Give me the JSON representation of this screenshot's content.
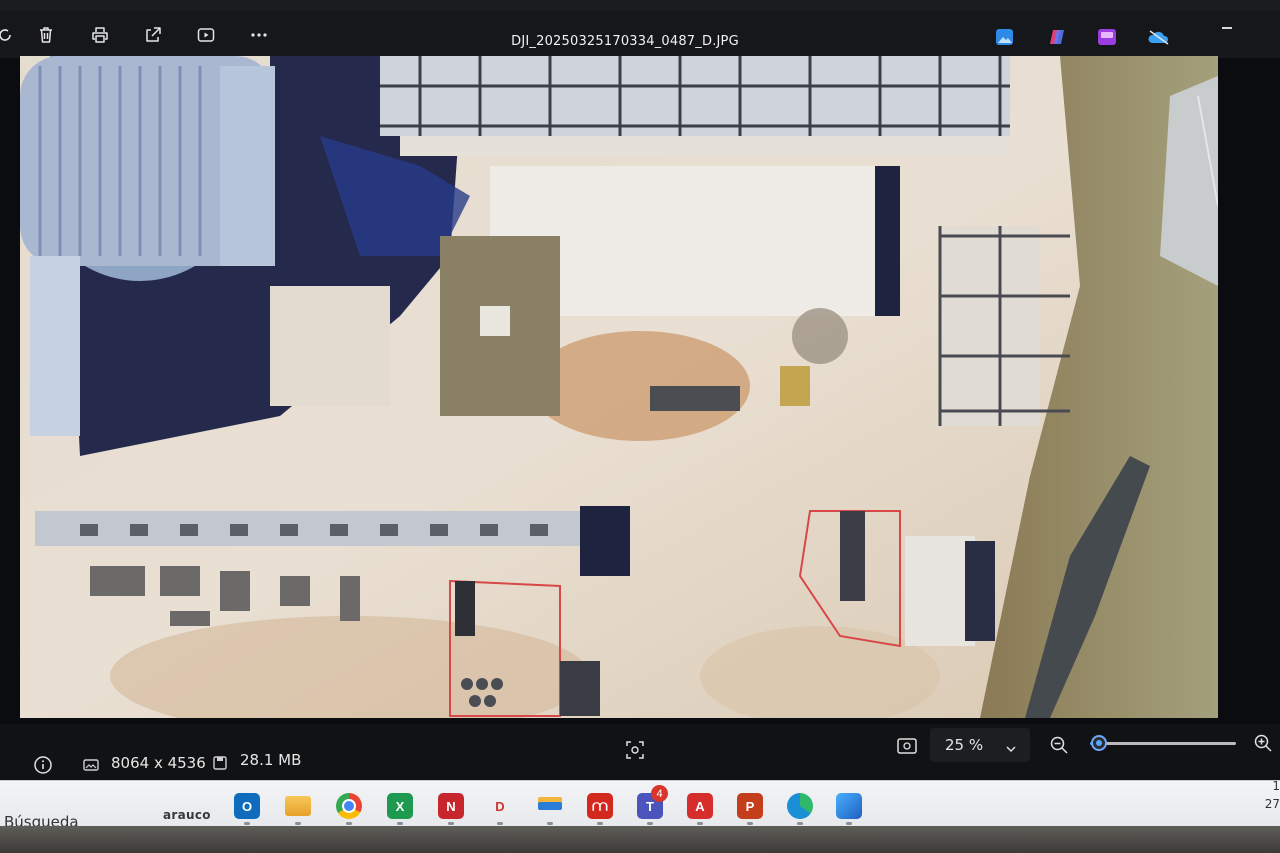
{
  "window": {
    "title": "DJI_20250325170334_0487_D.JPG"
  },
  "toolbar": {
    "buttons": [
      {
        "name": "delete",
        "icon": "trash-icon"
      },
      {
        "name": "print",
        "icon": "printer-icon"
      },
      {
        "name": "share",
        "icon": "share-icon"
      },
      {
        "name": "slideshow",
        "icon": "play-icon"
      },
      {
        "name": "more",
        "icon": "ellipsis-icon"
      }
    ],
    "app_icons": [
      "photos-edit-icon",
      "copilot-icon",
      "clipchamp-icon",
      "onedrive-icon"
    ]
  },
  "status": {
    "dimensions": "8064 x 4536",
    "file_size": "28.1 MB",
    "zoom_label": "25 %",
    "zoom_fraction": 0.05
  },
  "taskbar": {
    "search_label": "Búsqueda",
    "search_brand": "arauco",
    "teams_badge": "4",
    "apps": [
      {
        "name": "outlook",
        "icon": "outlook-icon",
        "color": "#0f6cbd",
        "glyph": "O"
      },
      {
        "name": "file-explorer",
        "icon": "folder-icon",
        "color": "#f4b63f",
        "glyph": ""
      },
      {
        "name": "chrome",
        "icon": "chrome-icon",
        "color": "#34a853",
        "glyph": ""
      },
      {
        "name": "excel",
        "icon": "excel-icon",
        "color": "#1d9a4f",
        "glyph": "X"
      },
      {
        "name": "news",
        "icon": "news-icon",
        "color": "#c8262d",
        "glyph": "N"
      },
      {
        "name": "app-d",
        "icon": "d-app-icon",
        "color": "#ffffff",
        "glyph": "D"
      },
      {
        "name": "folder-app",
        "icon": "stack-icon",
        "color": "#ffffff",
        "glyph": ""
      },
      {
        "name": "acrobat",
        "icon": "pdf-icon",
        "color": "#d2281e",
        "glyph": ""
      },
      {
        "name": "teams",
        "icon": "teams-icon",
        "color": "#4b53bc",
        "glyph": "T"
      },
      {
        "name": "autocad",
        "icon": "autocad-icon",
        "color": "#d62d2d",
        "glyph": "A"
      },
      {
        "name": "powerpoint",
        "icon": "powerpoint-icon",
        "color": "#c43e1c",
        "glyph": "P"
      },
      {
        "name": "edge",
        "icon": "edge-icon",
        "color": "#1b8fd6",
        "glyph": ""
      },
      {
        "name": "photos",
        "icon": "photos-icon",
        "color": "#2f7fd6",
        "glyph": ""
      }
    ],
    "clock_time": "1",
    "clock_date": "27"
  }
}
